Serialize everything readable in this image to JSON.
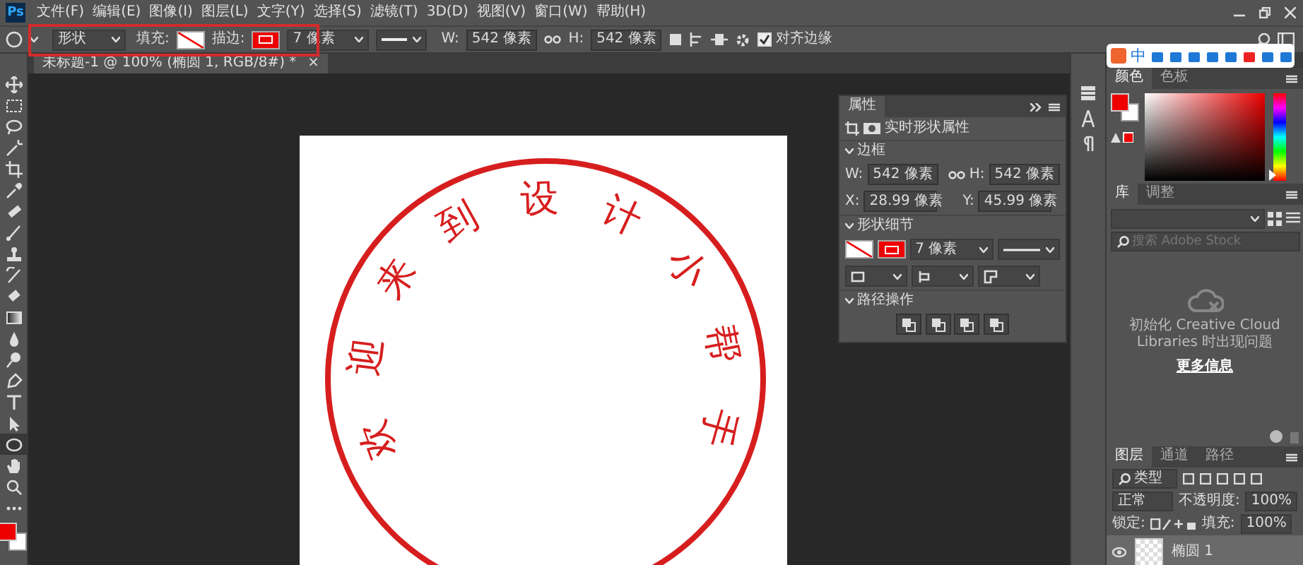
{
  "app_icon": "Ps",
  "menu": [
    "文件(F)",
    "编辑(E)",
    "图像(I)",
    "图层(L)",
    "文字(Y)",
    "选择(S)",
    "滤镜(T)",
    "3D(D)",
    "视图(V)",
    "窗口(W)",
    "帮助(H)"
  ],
  "ime_toolbar": {
    "label": "中"
  },
  "options_bar": {
    "tool_mode": "形状",
    "fill_label": "填充:",
    "stroke_label": "描边:",
    "stroke_width": "7 像素",
    "w_label": "W:",
    "w_value": "542 像素",
    "h_label": "H:",
    "h_value": "542 像素",
    "align_edges": {
      "label": "对齐边缘",
      "checked": true
    }
  },
  "document_tab": {
    "title": "未标题-1 @ 100% (椭圆 1, RGB/8#) *",
    "close": "×"
  },
  "tools": [
    {
      "kind": "move",
      "selected": false
    },
    {
      "kind": "marquee",
      "selected": false
    },
    {
      "kind": "lasso",
      "selected": false
    },
    {
      "kind": "wand",
      "selected": false
    },
    {
      "kind": "crop",
      "selected": false
    },
    {
      "kind": "eyedropper",
      "selected": false
    },
    {
      "kind": "healing",
      "selected": false
    },
    {
      "kind": "brush",
      "selected": false
    },
    {
      "kind": "stamp",
      "selected": false
    },
    {
      "kind": "history",
      "selected": false
    },
    {
      "kind": "eraser",
      "selected": false
    },
    {
      "kind": "gradient",
      "selected": false
    },
    {
      "kind": "blur",
      "selected": false
    },
    {
      "kind": "dodge",
      "selected": false
    },
    {
      "kind": "pen",
      "selected": false
    },
    {
      "kind": "type",
      "selected": false
    },
    {
      "kind": "select",
      "selected": false
    },
    {
      "kind": "ellipse",
      "selected": true
    },
    {
      "kind": "hand",
      "selected": false
    },
    {
      "kind": "zoom",
      "selected": false
    },
    {
      "kind": "more",
      "selected": false
    }
  ],
  "stamp": {
    "characters": [
      "欢",
      "迎",
      "来",
      "到",
      "设",
      "计",
      "小",
      "帮",
      "手"
    ]
  },
  "properties_panel": {
    "tab": "属性",
    "subtitle": "实时形状属性",
    "transform_title": "边框",
    "w_label": "W:",
    "w_value": "542 像素",
    "h_label": "H:",
    "h_value": "542 像素",
    "x_label": "X:",
    "x_value": "28.99 像素",
    "y_label": "Y:",
    "y_value": "45.99 像素",
    "shape_title": "形状细节",
    "stroke_width": "7 像素",
    "path_title": "路径操作"
  },
  "color_panel": {
    "tabs": [
      {
        "label": "颜色",
        "selected": true
      },
      {
        "label": "色板",
        "selected": false
      }
    ],
    "hue": {
      "level": 0.0
    }
  },
  "libraries_panel": {
    "tabs": [
      {
        "label": "库",
        "selected": true
      },
      {
        "label": "调整",
        "selected": false
      }
    ],
    "search_placeholder": "搜索 Adobe Stock",
    "message": "初始化 Creative Cloud Libraries 时出现问题",
    "link": "更多信息"
  },
  "layers_panel": {
    "tabs": [
      {
        "label": "图层",
        "selected": true
      },
      {
        "label": "通道",
        "selected": false
      },
      {
        "label": "路径",
        "selected": false
      }
    ],
    "filter": "类型",
    "blend_mode": "正常",
    "opacity_label": "不透明度:",
    "opacity": "100%",
    "lock_label": "锁定:",
    "fill_label": "填充:",
    "fill": "100%",
    "layers": [
      {
        "name": "椭圆 1",
        "visible": true,
        "selected": true
      }
    ]
  }
}
